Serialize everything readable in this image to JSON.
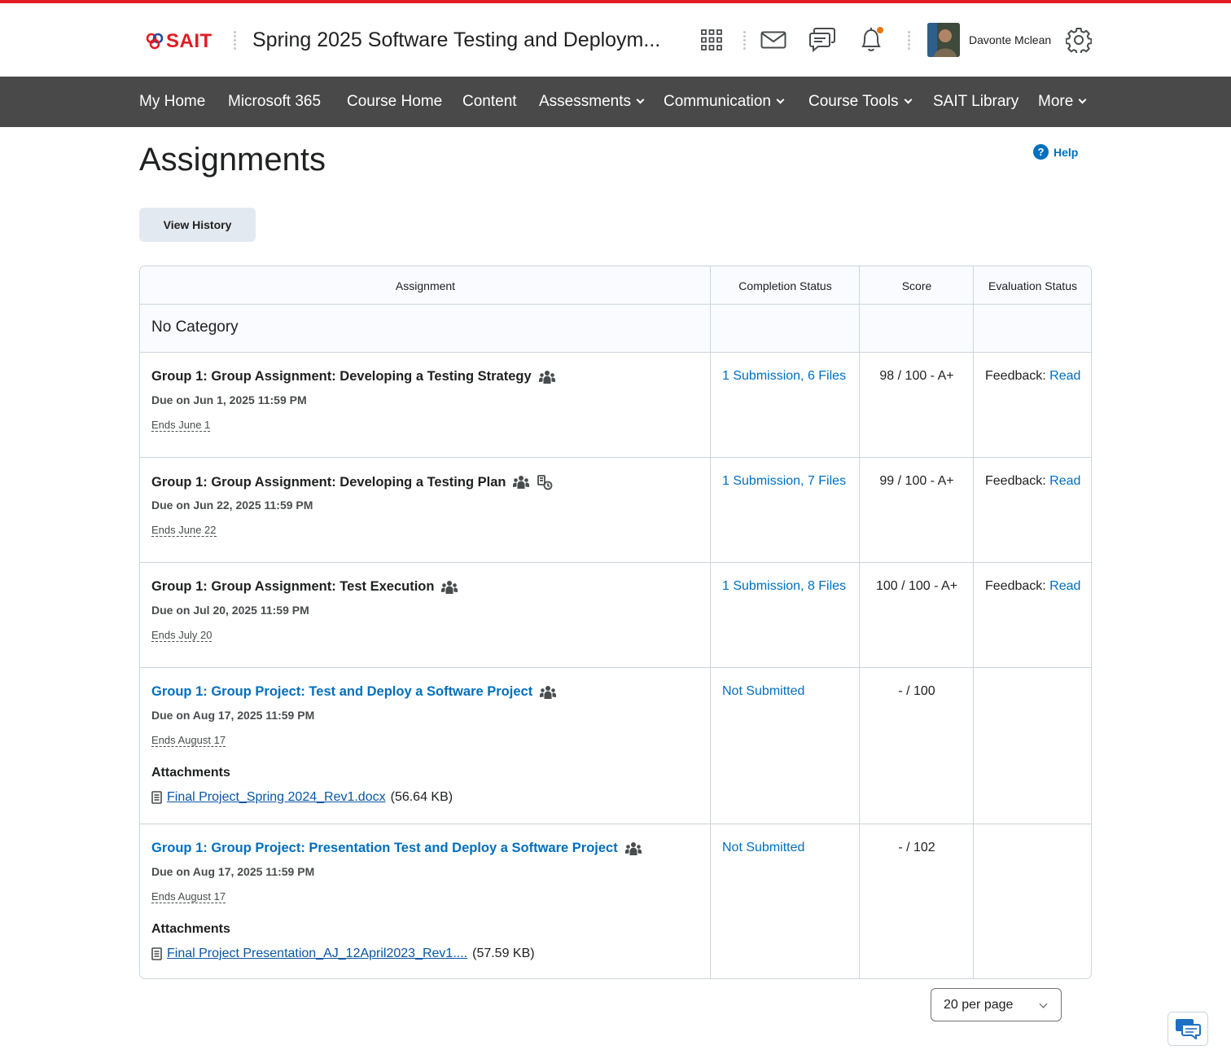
{
  "header": {
    "logo_text": "SAIT",
    "course_title": "Spring 2025 Software Testing and Deploym...",
    "user_name": "Davonte Mclean",
    "icons": [
      "apps-grid-icon",
      "mail-icon",
      "chat-icon",
      "bell-icon",
      "gear-icon"
    ],
    "accent_color": "#e31b23",
    "notification_color": "#e87511"
  },
  "nav": {
    "items": [
      {
        "label": "My Home",
        "dropdown": false
      },
      {
        "label": "Microsoft 365",
        "dropdown": false
      },
      {
        "label": "Course Home",
        "dropdown": false
      },
      {
        "label": "Content",
        "dropdown": false
      },
      {
        "label": "Assessments",
        "dropdown": true
      },
      {
        "label": "Communication",
        "dropdown": true
      },
      {
        "label": "Course Tools",
        "dropdown": true
      },
      {
        "label": "SAIT Library",
        "dropdown": false
      },
      {
        "label": "More",
        "dropdown": true
      }
    ]
  },
  "page": {
    "title": "Assignments",
    "help_label": "Help",
    "view_history_label": "View History"
  },
  "table": {
    "headers": {
      "assignment": "Assignment",
      "completion": "Completion Status",
      "score": "Score",
      "evaluation": "Evaluation Status"
    },
    "category": "No Category",
    "rows": [
      {
        "title": "Group 1: Group Assignment: Developing a Testing Strategy",
        "is_link": false,
        "due": "Due on Jun 1, 2025 11:59 PM",
        "ends": "Ends June 1",
        "completion": "1 Submission, 6 Files",
        "score": "98 / 100 - A+",
        "eval_prefix": "Feedback:",
        "eval_link": "Read"
      },
      {
        "title": "Group 1: Group Assignment: Developing a Testing Plan",
        "is_link": false,
        "due": "Due on Jun 22, 2025 11:59 PM",
        "ends": "Ends June 22",
        "completion": "1 Submission, 7 Files",
        "score": "99 / 100 - A+",
        "eval_prefix": "Feedback:",
        "eval_link": "Read"
      },
      {
        "title": "Group 1: Group Assignment: Test Execution",
        "is_link": false,
        "due": "Due on Jul 20, 2025 11:59 PM",
        "ends": "Ends July 20",
        "completion": "1 Submission, 8 Files",
        "score": "100 / 100 - A+",
        "eval_prefix": "Feedback:",
        "eval_link": "Read"
      },
      {
        "title": "Group 1: Group Project: Test and Deploy a Software Project",
        "is_link": true,
        "due": "Due on Aug 17, 2025 11:59 PM",
        "ends": "Ends August 17",
        "attachments_heading": "Attachments",
        "attachment_name": "Final Project_Spring 2024_Rev1.docx",
        "attachment_size": "(56.64 KB)",
        "completion": "Not Submitted",
        "score": "- / 100"
      },
      {
        "title": "Group 1: Group Project: Presentation Test and Deploy a Software Project",
        "is_link": true,
        "due": "Due on Aug 17, 2025 11:59 PM",
        "ends": "Ends August 17",
        "attachments_heading": "Attachments",
        "attachment_name": "Final Project Presentation_AJ_12April2023_Rev1....",
        "attachment_size": "(57.59 KB)",
        "completion": "Not Submitted",
        "score": "- / 102"
      }
    ]
  },
  "pager": {
    "selected": "20 per page"
  }
}
